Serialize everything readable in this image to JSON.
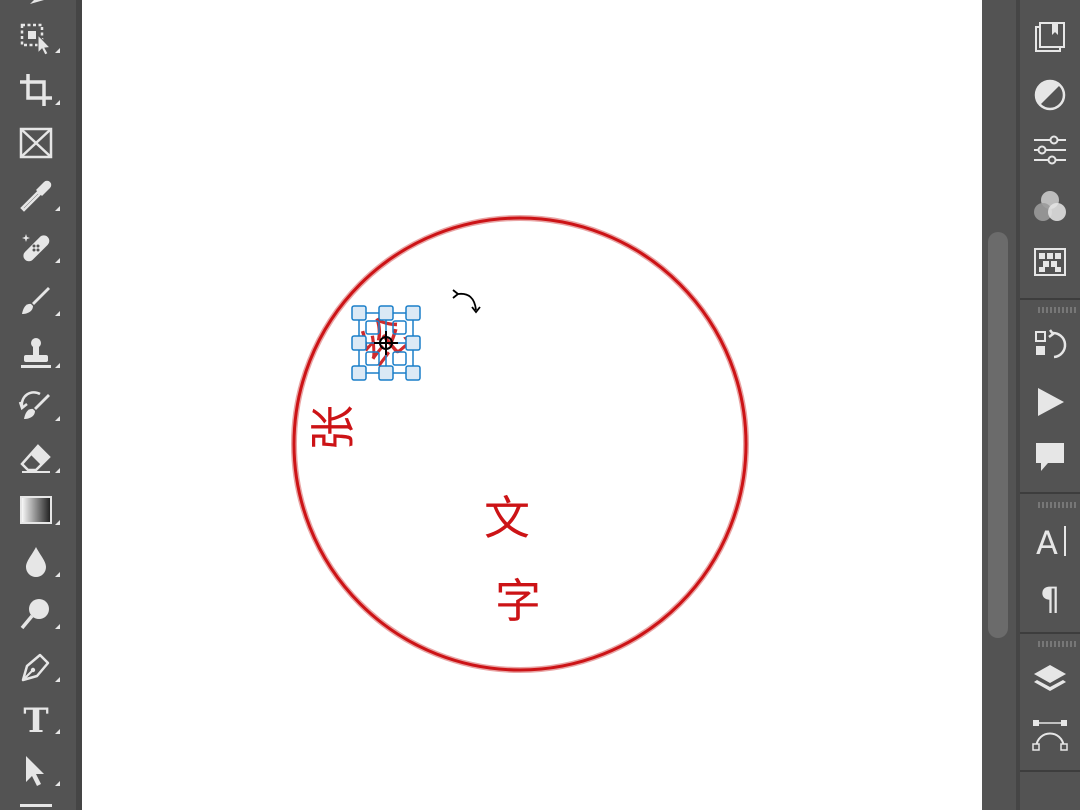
{
  "toolbar": {
    "tools": [
      {
        "name": "object-selection",
        "icon": "object-selection-icon"
      },
      {
        "name": "crop",
        "icon": "crop-icon"
      },
      {
        "name": "frame",
        "icon": "frame-icon"
      },
      {
        "name": "eyedropper",
        "icon": "eyedropper-icon"
      },
      {
        "name": "spot-healing",
        "icon": "bandage-icon"
      },
      {
        "name": "brush",
        "icon": "brush-icon"
      },
      {
        "name": "clone-stamp",
        "icon": "stamp-icon"
      },
      {
        "name": "history-brush",
        "icon": "history-brush-icon"
      },
      {
        "name": "eraser",
        "icon": "eraser-icon"
      },
      {
        "name": "gradient",
        "icon": "gradient-icon"
      },
      {
        "name": "blur",
        "icon": "drop-icon"
      },
      {
        "name": "dodge",
        "icon": "dodge-icon"
      },
      {
        "name": "pen",
        "icon": "pen-icon"
      },
      {
        "name": "type",
        "icon": "type-icon"
      },
      {
        "name": "path-selection",
        "icon": "arrow-icon"
      }
    ],
    "type_tool_glyph": "T"
  },
  "canvas": {
    "stamp": {
      "border_color": "#cc1316",
      "characters": [
        "张",
        "纶",
        "文",
        "字"
      ]
    }
  },
  "right_panel": {
    "character_glyph": "A",
    "paragraph_glyph": "¶",
    "icons": [
      "libraries-icon",
      "adjustments-icon",
      "properties-icon",
      "channels-icon",
      "patterns-icon",
      "history-icon",
      "actions-icon",
      "comments-icon",
      "character-icon",
      "paragraph-icon",
      "layers-icon",
      "paths-icon"
    ]
  },
  "colors": {
    "ui_bg": "#535353",
    "ui_icon": "#e6e6e6",
    "selection": "#1a7fc9",
    "stamp_red": "#cc1316"
  }
}
